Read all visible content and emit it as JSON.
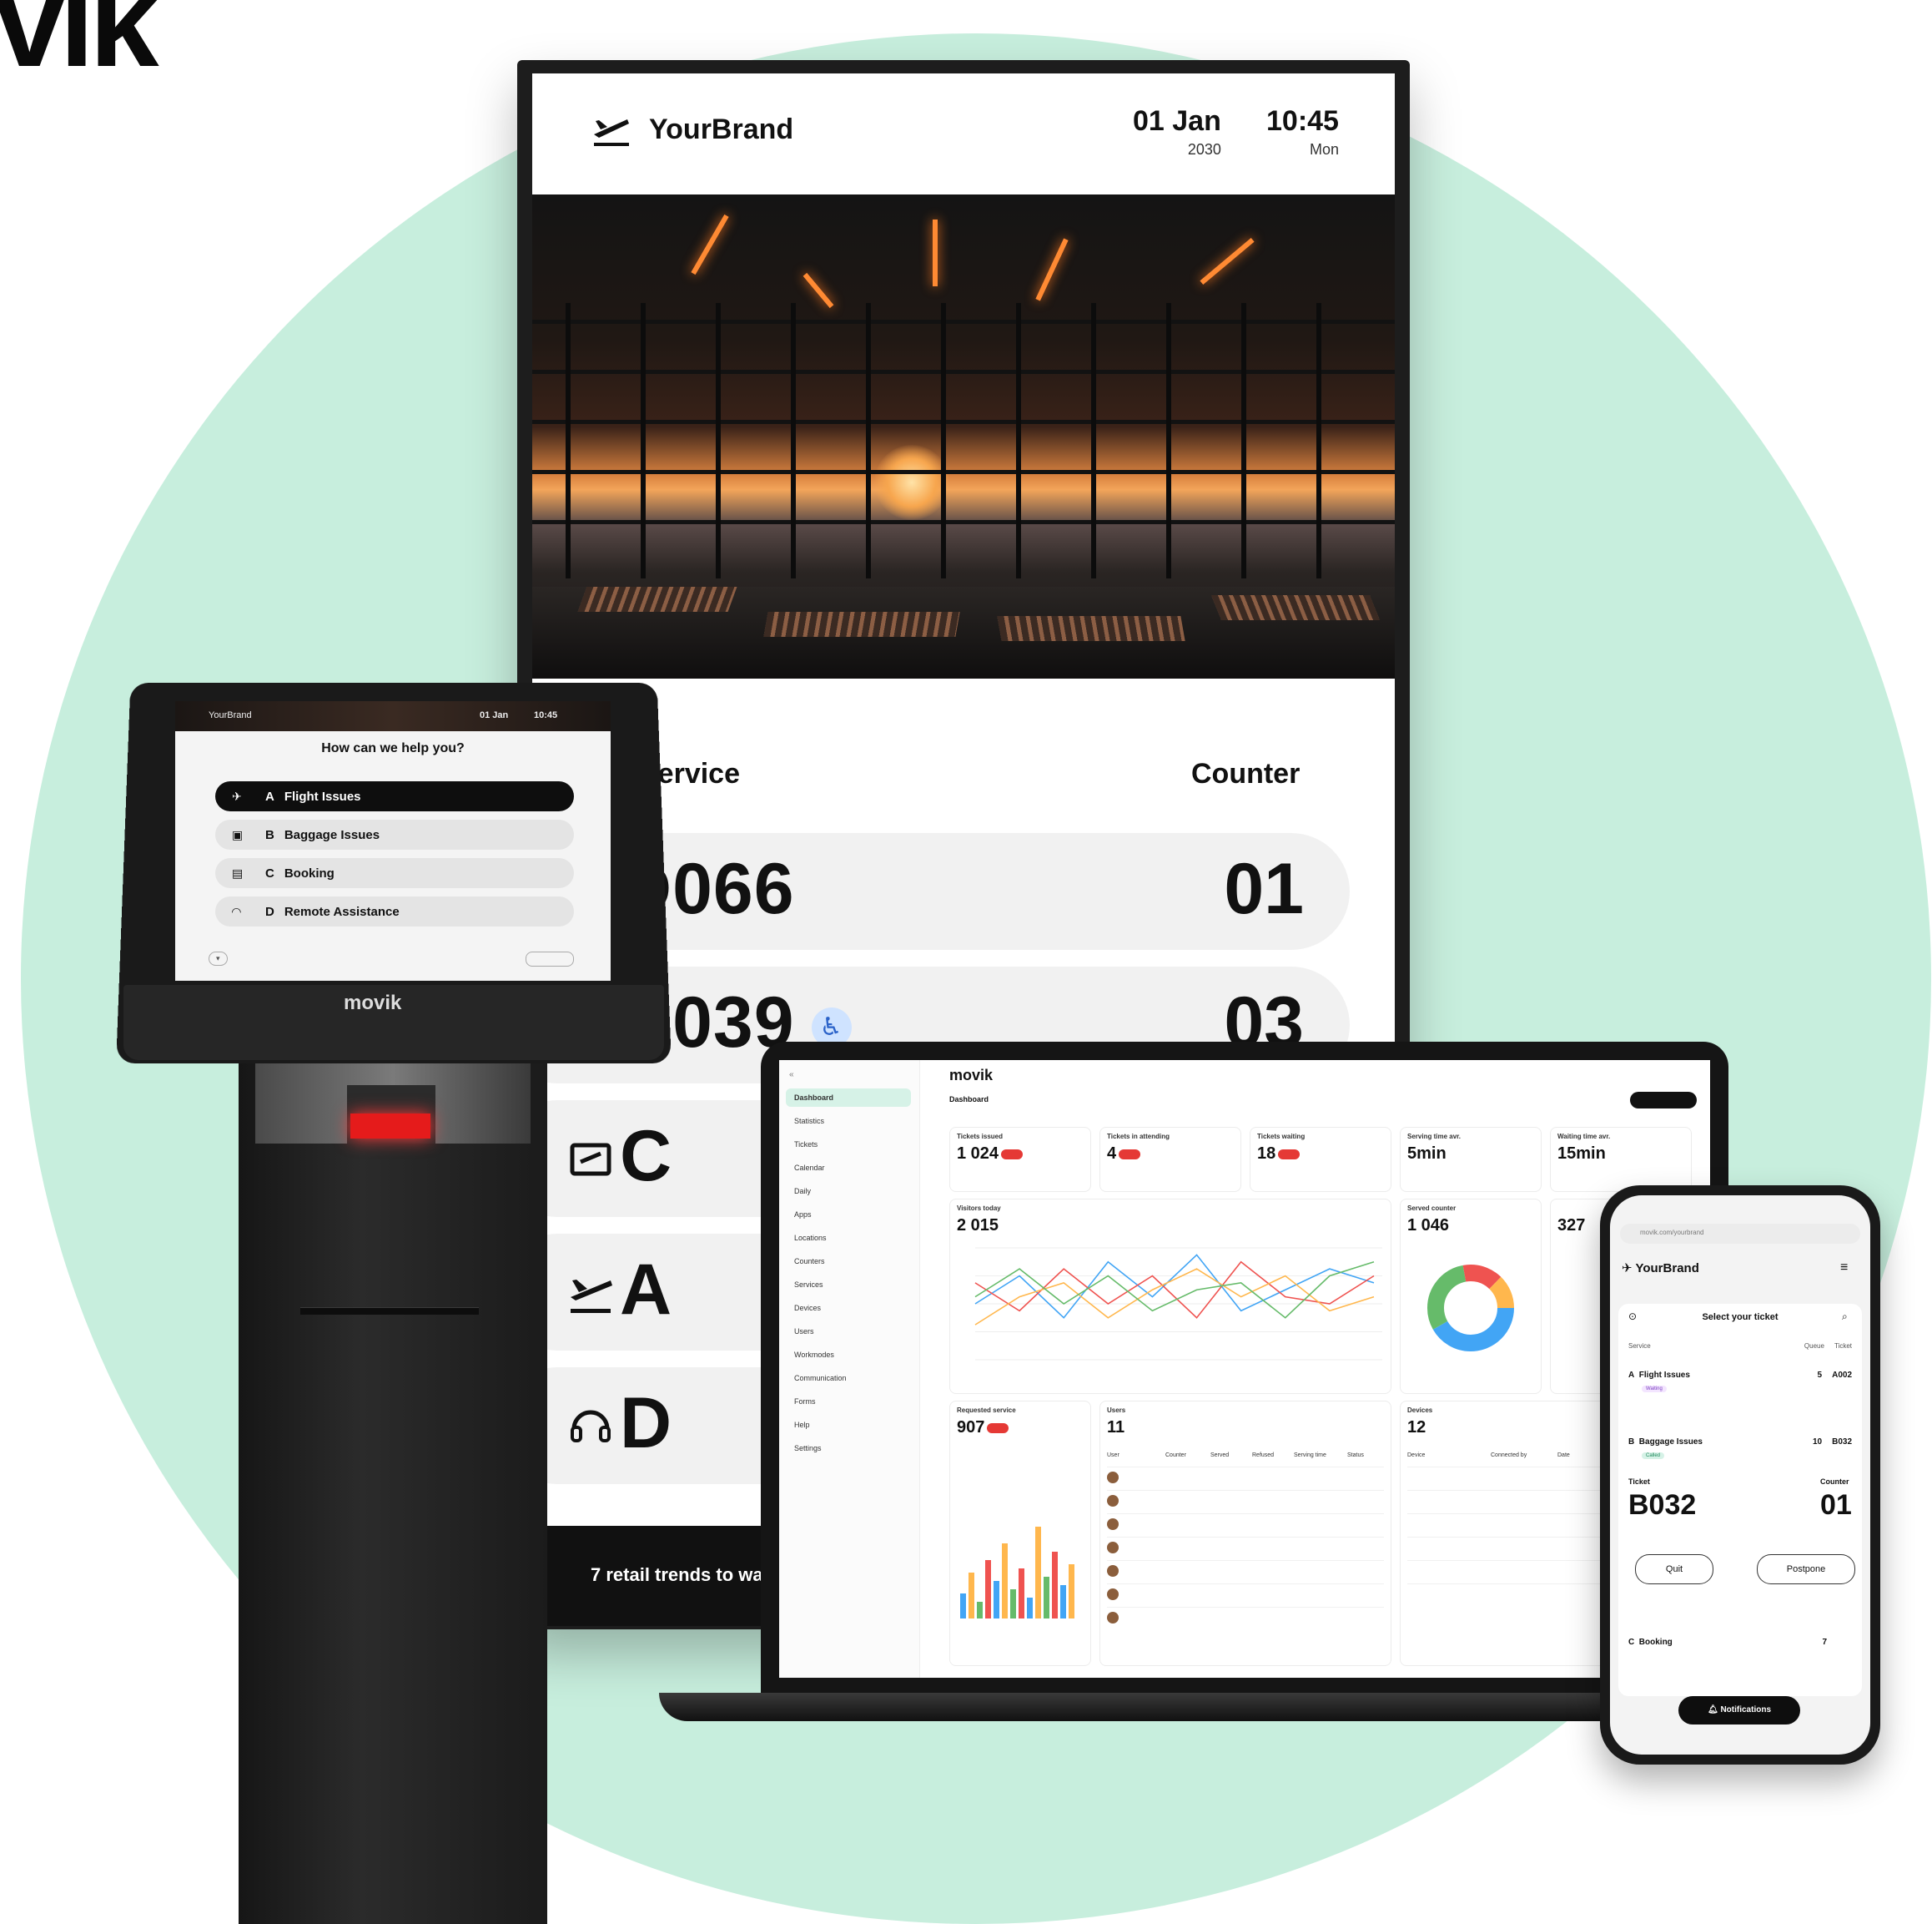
{
  "corner_logo": "vik",
  "colors": {
    "background_circle": "#c7eedd",
    "accent_green": "#d6f2e7",
    "badge_red": "#e53935"
  },
  "display": {
    "brand": "YourBrand",
    "date": "01 Jan",
    "year": "2030",
    "time": "10:45",
    "weekday": "Mon",
    "service_header": "Service",
    "counter_header": "Counter",
    "rows": [
      {
        "ticket": "D066",
        "counter": "01",
        "icon": "headset-icon"
      },
      {
        "ticket": "B039",
        "counter": "03",
        "icon": "baggage-icon",
        "accessibility": "♿"
      },
      {
        "ticket": "C",
        "icon": "booking-icon"
      },
      {
        "ticket": "A",
        "icon": "plane-icon"
      },
      {
        "ticket": "D",
        "icon": "headset-icon"
      }
    ],
    "ticker": "7 retail trends to wa"
  },
  "kiosk": {
    "brand": "movik",
    "header_brand": "YourBrand",
    "header_date": "01 Jan",
    "header_time": "10:45",
    "question": "How can we help you?",
    "options": [
      {
        "key": "A",
        "label": "Flight Issues"
      },
      {
        "key": "B",
        "label": "Baggage Issues"
      },
      {
        "key": "C",
        "label": "Booking"
      },
      {
        "key": "D",
        "label": "Remote Assistance"
      }
    ]
  },
  "laptop": {
    "app": "movik",
    "page": "Dashboard",
    "nav": [
      "Dashboard",
      "Statistics",
      "Tickets",
      "Calendar",
      "Daily",
      "Apps",
      "Locations",
      "Counters",
      "Services",
      "Devices",
      "Users",
      "Workmodes",
      "Communication",
      "Forms",
      "Help",
      "Settings"
    ],
    "kpis": [
      {
        "title": "Tickets issued",
        "value": "1 024"
      },
      {
        "title": "Tickets in attending",
        "value": "4"
      },
      {
        "title": "Tickets waiting",
        "value": "18"
      },
      {
        "title": "Serving time avr.",
        "value": "5min"
      },
      {
        "title": "Waiting time avr.",
        "value": "15min"
      }
    ],
    "visitors": {
      "title": "Visitors today",
      "value": "2 015"
    },
    "served_counter": {
      "title": "Served counter",
      "value": "1 046"
    },
    "requested_right": {
      "value": "327"
    },
    "requested_service": {
      "title": "Requested service",
      "value": "907"
    },
    "users": {
      "title": "Users",
      "value": "11",
      "columns": [
        "User",
        "Counter",
        "Served",
        "Refused",
        "Serving time",
        "Status"
      ]
    },
    "devices": {
      "title": "Devices",
      "value": "12",
      "columns": [
        "Device",
        "Connected by",
        "Date"
      ]
    }
  },
  "chart_data": {
    "type": "line",
    "xlabel": "",
    "ylabel": "",
    "series": [
      {
        "values": [
          8,
          12,
          6,
          14,
          9,
          15,
          7,
          10,
          13,
          11
        ]
      },
      {
        "values": [
          11,
          7,
          13,
          8,
          12,
          6,
          14,
          9,
          8,
          12
        ]
      },
      {
        "values": [
          5,
          9,
          11,
          6,
          10,
          13,
          9,
          12,
          7,
          9
        ]
      },
      {
        "values": [
          9,
          13,
          8,
          12,
          7,
          10,
          11,
          6,
          12,
          14
        ]
      }
    ]
  },
  "phone": {
    "url": "movik.com/yourbrand",
    "brand": "YourBrand",
    "title": "Select your ticket",
    "col_service": "Service",
    "col_queue": "Queue",
    "col_ticket": "Ticket",
    "rows": [
      {
        "key": "A",
        "label": "Flight Issues",
        "queue": "5",
        "ticket": "A002",
        "status": "Waiting"
      },
      {
        "key": "B",
        "label": "Baggage Issues",
        "queue": "10",
        "ticket": "B032",
        "status": "Called"
      }
    ],
    "ticket_label": "Ticket",
    "ticket": "B032",
    "counter_label": "Counter",
    "counter": "01",
    "quit": "Quit",
    "postpone": "Postpone",
    "next_row": {
      "key": "C",
      "label": "Booking",
      "queue": "7"
    },
    "notifications": "Notifications"
  }
}
